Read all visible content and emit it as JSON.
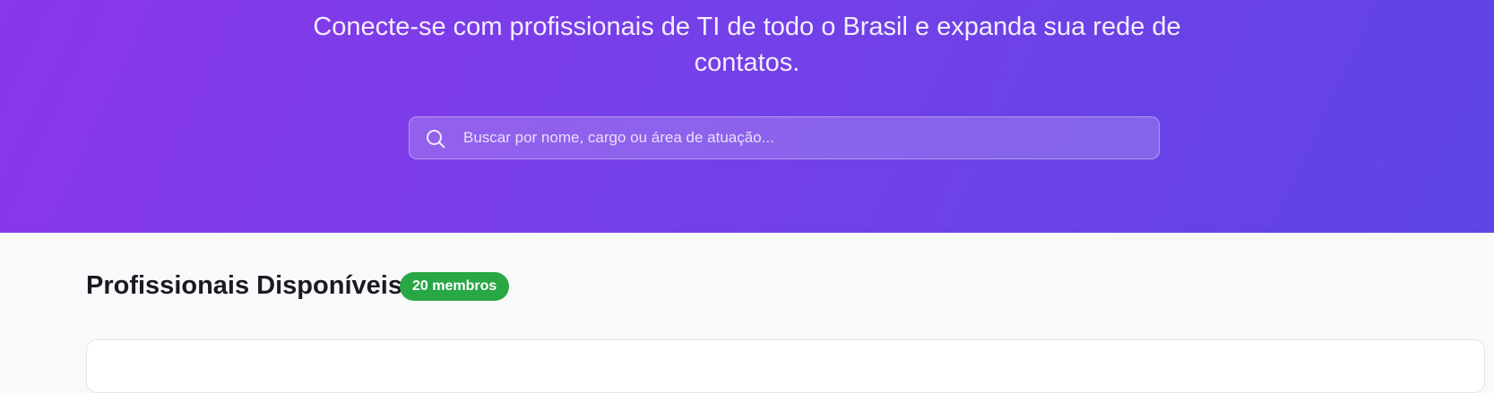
{
  "hero": {
    "subtitle": "Conecte-se com profissionais de TI de todo o Brasil e expanda sua rede de contatos."
  },
  "search": {
    "placeholder": "Buscar por nome, cargo ou área de atuação...",
    "value": "",
    "icon": "search-icon"
  },
  "section": {
    "title": "Profissionais Disponíveis",
    "badge": "20 membros"
  },
  "colors": {
    "hero_gradient_start": "#8a36ea",
    "hero_gradient_end": "#5f44e4",
    "badge_green": "#28a745",
    "page_background": "#f8f9fb"
  }
}
